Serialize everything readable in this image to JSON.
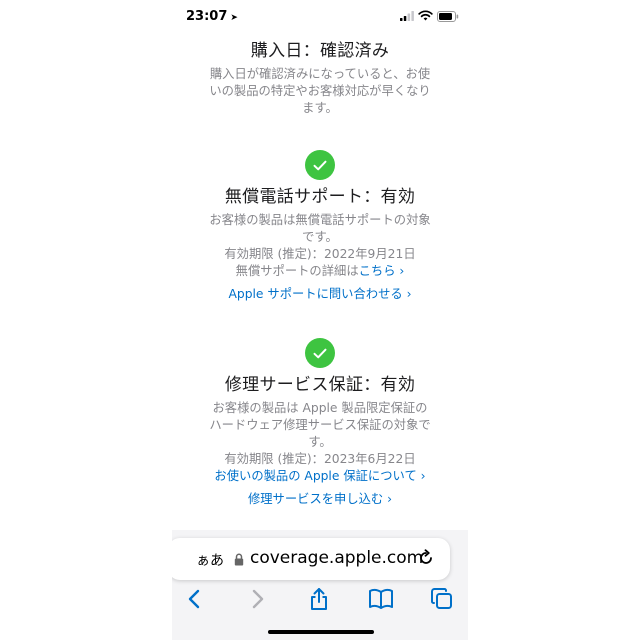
{
  "status_bar": {
    "time": "23:07",
    "location_glyph": "➤"
  },
  "purchase": {
    "title": "購入日：確認済み",
    "desc_lines": [
      "購入日が確認済みになっていると、お使",
      "いの製品の特定やお客様対応が早くなり",
      "ます。"
    ]
  },
  "phone_support": {
    "title": "無償電話サポート：有効",
    "desc_lines": [
      "お客様の製品は無償電話サポートの対象",
      "です。"
    ],
    "expiry": "有効期限 (推定)：2022年9月21日",
    "details_prefix": "無償サポートの詳細は",
    "details_link": "こちら ›",
    "contact_link": "Apple サポートに問い合わせる ›"
  },
  "repair": {
    "title": "修理サービス保証：有効",
    "desc_lines": [
      "お客様の製品は Apple 製品限定保証の",
      "ハードウェア修理サービス保証の対象で",
      "す。"
    ],
    "expiry": "有効期限 (推定)：2023年6月22日",
    "warranty_link": "お使いの製品の Apple 保証について ›",
    "request_link": "修理サービスを申し込む ›"
  },
  "browser": {
    "aa_label": "ぁあ",
    "url": "coverage.apple.com"
  },
  "icons": [
    "check-icon",
    "lock-icon",
    "reload-icon",
    "back-icon",
    "forward-icon",
    "share-icon",
    "bookmarks-icon",
    "tabs-icon"
  ],
  "colors": {
    "link": "#0070c9",
    "check": "#3ec441",
    "secondary_text": "#86868b"
  }
}
